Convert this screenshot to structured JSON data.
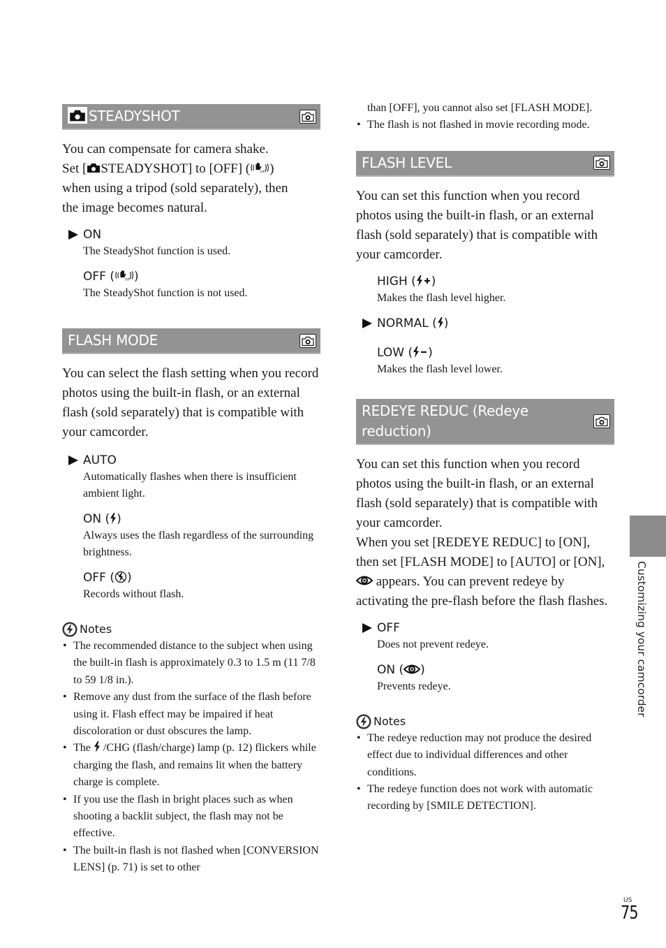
{
  "left_column": {
    "steadyshot": {
      "title": "STEADYSHOT",
      "body": [
        "You can compensate for camera shake.",
        "Set [",
        "STEADYSHOT] to [OFF] (",
        ")",
        "when using a tripod (sold separately), then",
        "the image becomes natural."
      ],
      "options": [
        {
          "label": "ON",
          "desc": "The SteadyShot function is used.",
          "default": true
        },
        {
          "label": "OFF (",
          "label_suffix": ")",
          "icon": "steadyshot-off-icon",
          "desc": "The SteadyShot function is not used.",
          "default": false
        }
      ]
    },
    "flash_mode": {
      "title": "FLASH MODE",
      "body": "You can select the flash setting when you record photos using the built-in flash, or an external flash (sold separately) that is compatible with your camcorder.",
      "options": [
        {
          "label": "AUTO",
          "desc": "Automatically flashes when there is insufficient ambient light.",
          "default": true
        },
        {
          "label": "ON (",
          "label_suffix": ")",
          "icon": "flash-on-icon",
          "desc": "Always uses the flash regardless of the surrounding brightness.",
          "default": false
        },
        {
          "label": "OFF (",
          "label_suffix": ")",
          "icon": "flash-off-icon",
          "desc": "Records without flash.",
          "default": false
        }
      ],
      "notes_heading": "Notes",
      "notes": [
        "The recommended distance to the subject when using the built-in flash is approximately 0.3 to 1.5 m (11 7/8 to 59 1/8 in.).",
        "Remove any dust from the surface of the flash before using it. Flash effect may be impaired if heat discoloration or dust obscures the lamp.",
        {
          "prefix": "The",
          "suffix": "/CHG (flash/charge) lamp (p. 12) flickers while charging the flash, and remains lit when the battery charge is complete."
        },
        "If you use the flash in bright places such as when shooting a backlit subject, the flash may not be effective.",
        "The built-in flash is not flashed when [CONVERSION LENS] (p. 71) is set to other"
      ]
    }
  },
  "right_column": {
    "notes_continued": [
      "than [OFF], you cannot also set [FLASH MODE].",
      "The flash is not flashed in movie recording mode."
    ],
    "flash_level": {
      "title": "FLASH LEVEL",
      "body": "You can set this function when you record photos using the built-in flash, or an external flash (sold separately) that is compatible with your camcorder.",
      "options": [
        {
          "label": "HIGH (",
          "label_suffix": ")",
          "icon": "flash-plus-icon",
          "desc": "Makes the flash level higher.",
          "default": false
        },
        {
          "label": "NORMAL (",
          "label_suffix": ")",
          "icon": "flash-on-icon",
          "desc": "",
          "default": true
        },
        {
          "label": "LOW (",
          "label_suffix": ")",
          "icon": "flash-minus-icon",
          "desc": "Makes the flash level lower.",
          "default": false
        }
      ]
    },
    "redeye": {
      "title": "REDEYE REDUC (Redeye reduction)",
      "body1": "You can set this function when you record photos using the built-in flash, or an external flash (sold separately) that is compatible with your camcorder.",
      "body2_prefix": "When you set [REDEYE REDUC] to [ON], then set [FLASH MODE] to [AUTO] or [ON],",
      "body2_suffix": "appears. You can prevent redeye by activating the pre-flash before the flash flashes.",
      "options": [
        {
          "label": "OFF",
          "desc": "Does not prevent redeye.",
          "default": true
        },
        {
          "label": "ON (",
          "label_suffix": ")",
          "icon": "redeye-icon",
          "desc": "Prevents redeye.",
          "default": false
        }
      ],
      "notes_heading": "Notes",
      "notes": [
        "The redeye reduction may not produce the desired effect due to individual differences and other conditions.",
        "The redeye function does not work with automatic recording by [SMILE DETECTION]."
      ]
    }
  },
  "side_tab": {
    "label": "Customizing your camcorder"
  },
  "footer": {
    "region": "US",
    "page_number": "75"
  }
}
